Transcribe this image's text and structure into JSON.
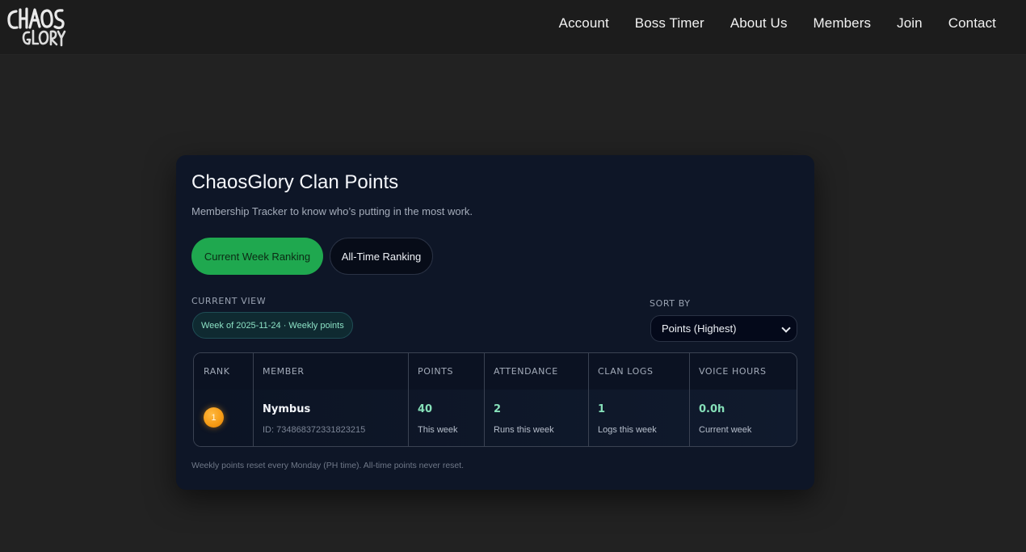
{
  "header": {
    "logo_text": "CHAOS GLORY",
    "nav": [
      {
        "label": "Account"
      },
      {
        "label": "Boss Timer"
      },
      {
        "label": "About Us"
      },
      {
        "label": "Members"
      },
      {
        "label": "Join"
      },
      {
        "label": "Contact"
      }
    ]
  },
  "card": {
    "title": "ChaosGlory Clan Points",
    "subtitle": "Membership Tracker to know who’s putting in the most work.",
    "tabs": [
      {
        "label": "Current Week Ranking",
        "active": true
      },
      {
        "label": "All-Time Ranking",
        "active": false
      }
    ],
    "current_view": {
      "label": "CURRENT VIEW",
      "value": "Week of 2025-11-24 · Weekly points"
    },
    "sort": {
      "label": "SORT BY",
      "selected": "Points (Highest)"
    },
    "table": {
      "headers": [
        "RANK",
        "MEMBER",
        "POINTS",
        "ATTENDANCE",
        "CLAN LOGS",
        "VOICE HOURS"
      ],
      "rows": [
        {
          "rank": "1",
          "member_name": "Nymbus",
          "member_id": "ID: 734868372331823215",
          "points": "40",
          "points_sub": "This week",
          "attendance": "2",
          "attendance_sub": "Runs this week",
          "clan_logs": "1",
          "clan_logs_sub": "Logs this week",
          "voice_hours": "0.0h",
          "voice_hours_sub": "Current week"
        }
      ]
    },
    "footnote": "Weekly points reset every Monday (PH time). All-time points never reset."
  },
  "colors": {
    "page_bg": "#222222",
    "header_bg": "#1c1c1c",
    "card_bg": "#0e1627",
    "accent_green": "#1fa84f",
    "value_green": "#86e0b9",
    "rank_gold": "#f59a14"
  }
}
